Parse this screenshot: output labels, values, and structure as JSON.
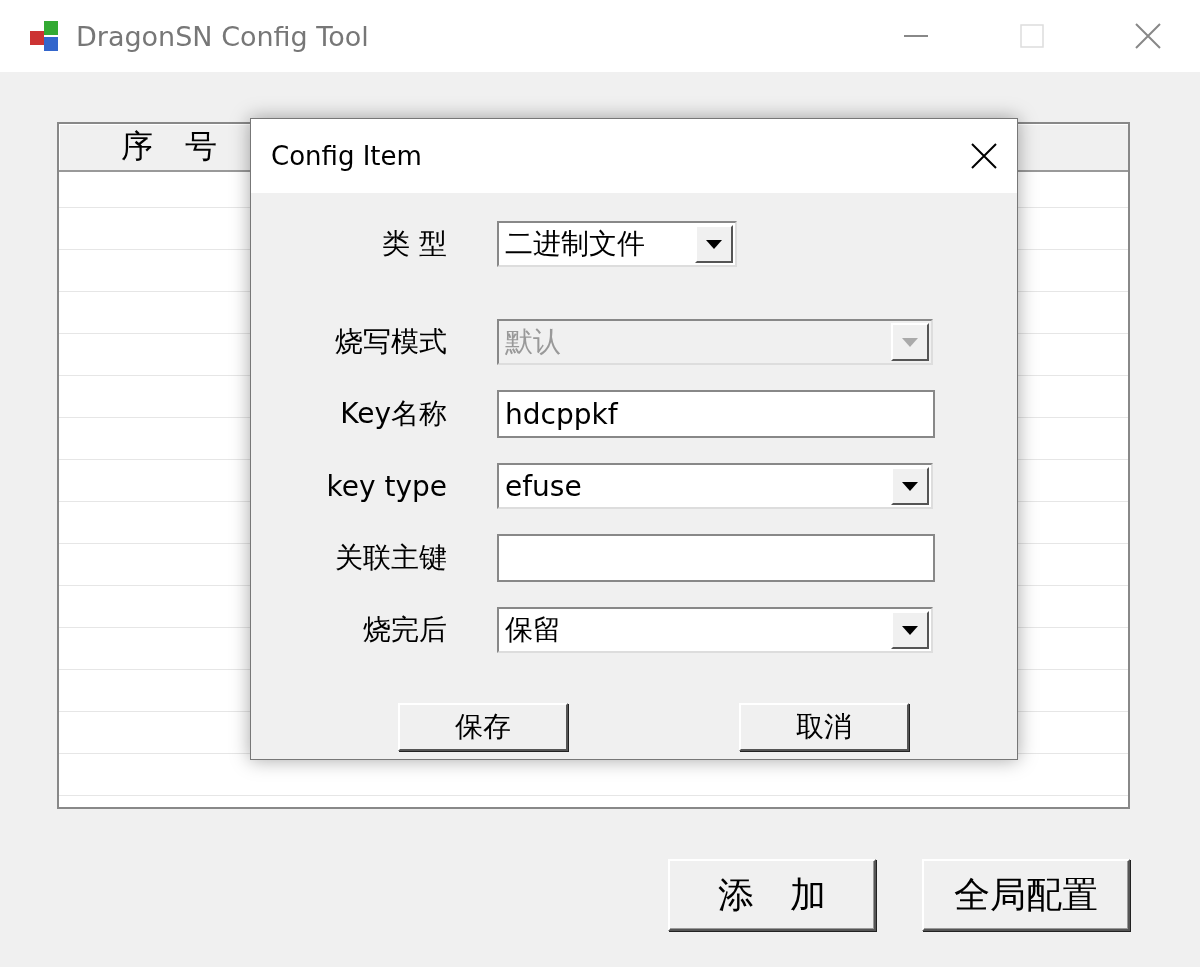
{
  "window": {
    "title": "DragonSN Config Tool"
  },
  "list": {
    "columns": [
      "序　号"
    ]
  },
  "dialog": {
    "title": "Config Item",
    "fields": [
      {
        "label": "类 型",
        "kind": "combo",
        "value": "二进制文件",
        "disabled": false,
        "short": true
      },
      {
        "label": "烧写模式",
        "kind": "combo",
        "value": "默认",
        "disabled": true,
        "short": false
      },
      {
        "label": "Key名称",
        "kind": "text",
        "value": "hdcppkf"
      },
      {
        "label": "key type",
        "kind": "combo",
        "value": "efuse",
        "disabled": false,
        "short": false
      },
      {
        "label": "关联主键",
        "kind": "text"
      },
      {
        "label": "烧完后",
        "kind": "combo",
        "value": "保留",
        "disabled": false,
        "short": false
      }
    ],
    "buttons": [
      "保存",
      "取消"
    ]
  },
  "buttons": [
    "添　加",
    "全局配置"
  ]
}
